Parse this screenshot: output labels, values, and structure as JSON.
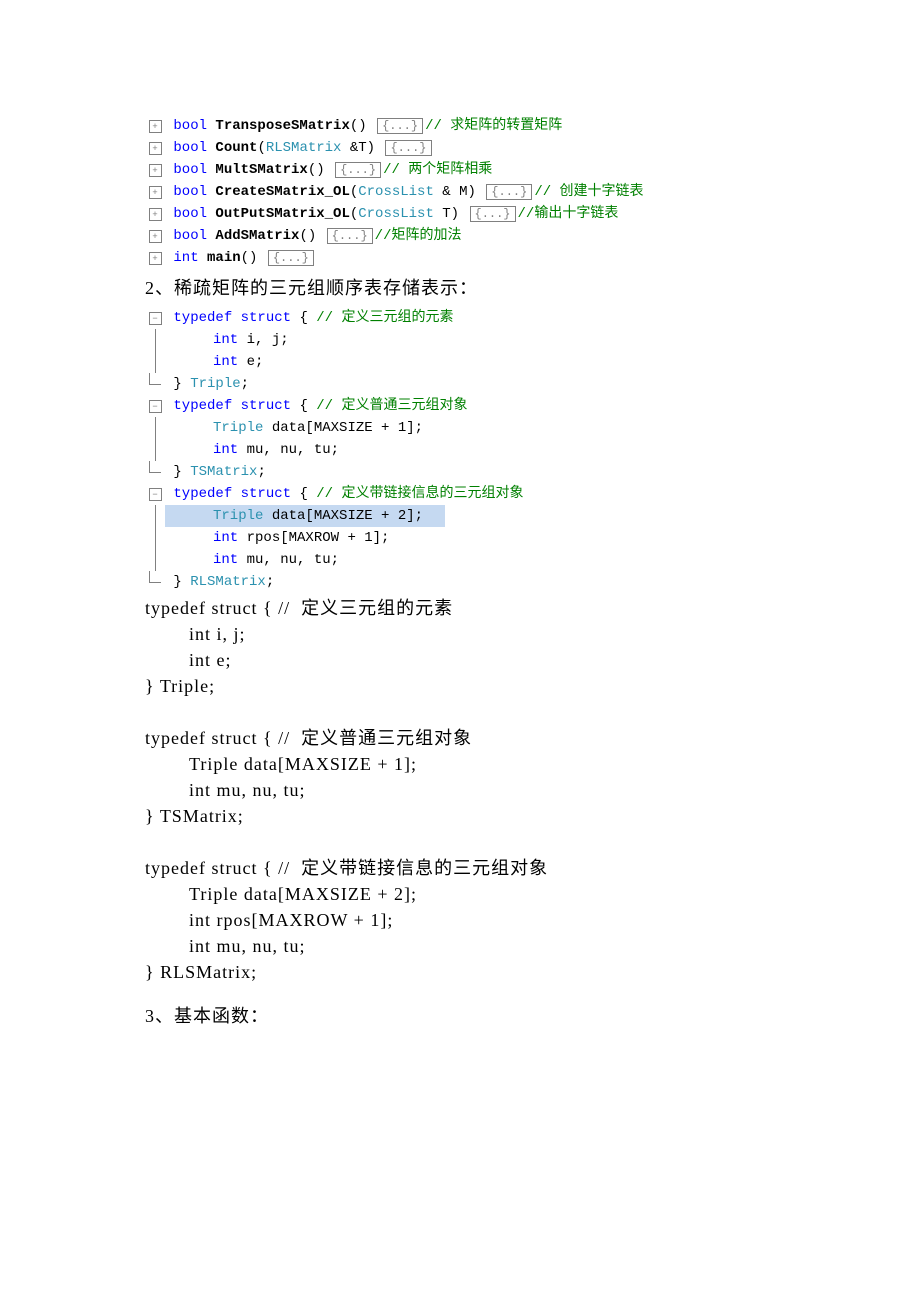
{
  "folded": [
    {
      "type": "bool",
      "name": "TransposeSMatrix",
      "params": "()",
      "comment": "// 求矩阵的转置矩阵"
    },
    {
      "type": "bool",
      "name": "Count",
      "params": "(RLSMatrix &T)",
      "comment": ""
    },
    {
      "type": "bool",
      "name": "MultSMatrix",
      "params": "()",
      "comment": "// 两个矩阵相乘"
    },
    {
      "type": "bool",
      "name": "CreateSMatrix_OL",
      "params": "(CrossList & M)",
      "comment": "//   创建十字链表"
    },
    {
      "type": "bool",
      "name": "OutPutSMatrix_OL",
      "params": "(CrossList T)",
      "comment": "//输出十字链表"
    },
    {
      "type": "bool",
      "name": "AddSMatrix",
      "params": "()",
      "comment": "//矩阵的加法"
    },
    {
      "type": "int",
      "name": "main",
      "params": "()",
      "comment": ""
    }
  ],
  "hd1": "2、稀疏矩阵的三元组顺序表存储表示：",
  "s1": {
    "sig": "typedef struct { ",
    "cm": "// 定义三元组的元素",
    "l1": "int i, j;",
    "l2": "int e;",
    "end": "} Triple;"
  },
  "s2": {
    "sig": "typedef struct { ",
    "cm": "// 定义普通三元组对象",
    "l1": "Triple data[MAXSIZE + 1];",
    "l2": "int mu, nu, tu;",
    "end": "} TSMatrix;"
  },
  "s3": {
    "sig": "typedef struct { ",
    "cm": "// 定义带链接信息的三元组对象",
    "l1": "Triple data[MAXSIZE + 2];",
    "l2": "int rpos[MAXROW + 1];",
    "l3": "int mu, nu, tu;",
    "end": "} RLSMatrix;"
  },
  "plain": "typedef struct { //  定义三元组的元素\n        int i, j;\n        int e;\n} Triple;\n\ntypedef struct { //  定义普通三元组对象\n        Triple data[MAXSIZE + 1];\n        int mu, nu, tu;\n} TSMatrix;\n\ntypedef struct { //  定义带链接信息的三元组对象\n        Triple data[MAXSIZE + 2];\n        int rpos[MAXROW + 1];\n        int mu, nu, tu;\n} RLSMatrix;",
  "hd2": "3、基本函数：",
  "fold": "{...}"
}
